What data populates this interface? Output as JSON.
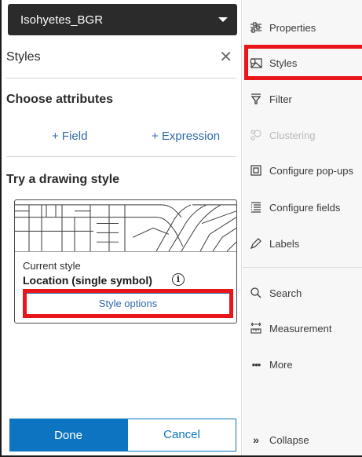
{
  "layer": {
    "name": "Isohyetes_BGR",
    "caret_icon": "chevron-down-icon"
  },
  "styles_panel": {
    "title": "Styles",
    "close_icon": "close-icon",
    "choose_attributes": {
      "heading": "Choose attributes",
      "field_link": "+ Field",
      "expression_link": "+ Expression"
    },
    "drawing_style": {
      "heading": "Try a drawing style",
      "card": {
        "current_label": "Current style",
        "location_label": "Location (single symbol)",
        "info_icon": "info-icon",
        "style_options_button": "Style options"
      }
    },
    "footer": {
      "done_label": "Done",
      "cancel_label": "Cancel"
    }
  },
  "side_nav": {
    "items": [
      {
        "label": "Properties",
        "icon": "properties-icon",
        "disabled": false
      },
      {
        "label": "Styles",
        "icon": "styles-icon",
        "disabled": false,
        "highlighted": true
      },
      {
        "label": "Filter",
        "icon": "filter-icon",
        "disabled": false
      },
      {
        "label": "Clustering",
        "icon": "clustering-icon",
        "disabled": true
      },
      {
        "label": "Configure pop-ups",
        "icon": "popup-icon",
        "disabled": false
      },
      {
        "label": "Configure fields",
        "icon": "fields-icon",
        "disabled": false
      },
      {
        "label": "Labels",
        "icon": "labels-icon",
        "disabled": false
      }
    ],
    "tools": [
      {
        "label": "Search",
        "icon": "search-icon"
      },
      {
        "label": "Measurement",
        "icon": "measurement-icon"
      },
      {
        "label": "More",
        "icon": "more-icon"
      }
    ],
    "collapse_label": "Collapse"
  },
  "colors": {
    "accent": "#0d74c1",
    "link": "#2d6aad",
    "highlight": "#e8161b",
    "layer_bar": "#2b2b2b"
  }
}
